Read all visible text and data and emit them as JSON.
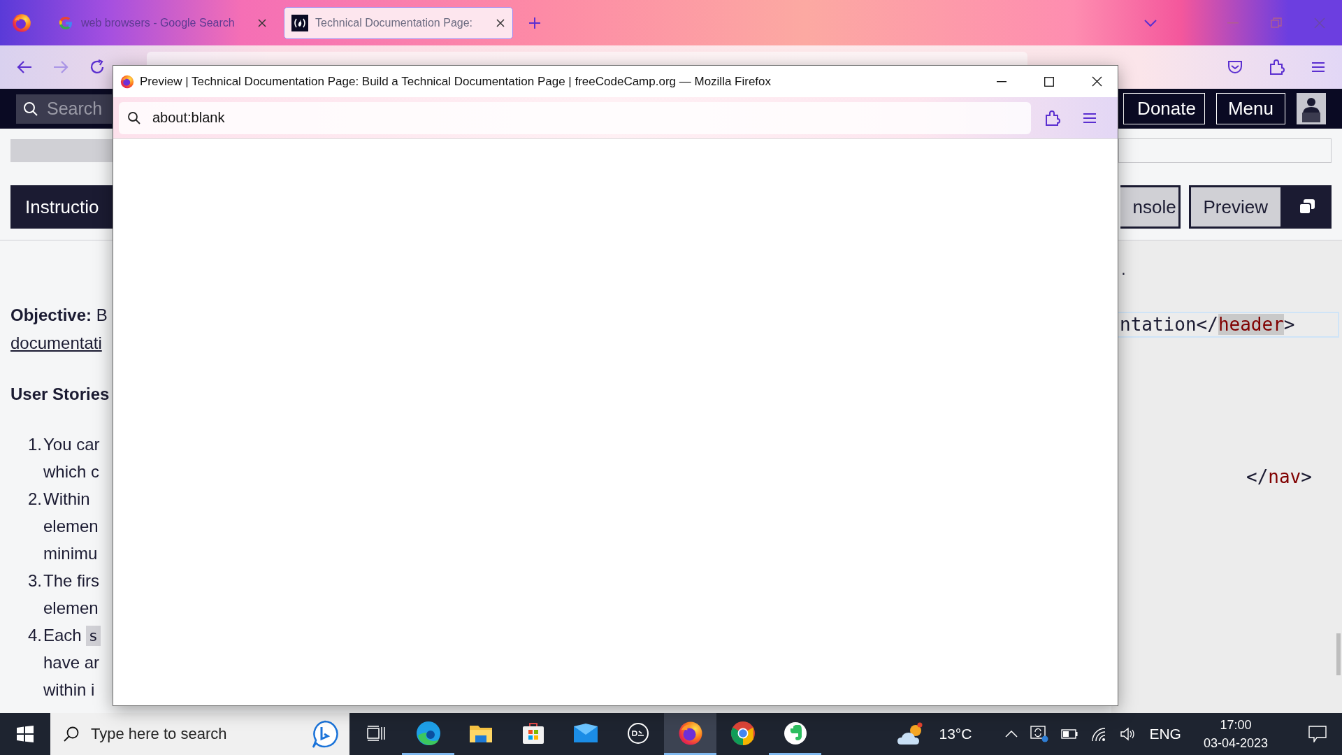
{
  "browser": {
    "tabs": [
      {
        "title": "web browsers - Google Search",
        "selected": false
      },
      {
        "title": "Technical Documentation Page:",
        "selected": true
      }
    ]
  },
  "site_nav": {
    "search_placeholder": "Search",
    "buttons": [
      "Donate",
      "Menu"
    ]
  },
  "left_tabs": [
    {
      "label": "Instructio",
      "selected": true
    }
  ],
  "right_tabs": [
    {
      "label": "nsole",
      "selected": false
    },
    {
      "label": "Preview",
      "selected": false
    }
  ],
  "instructions": {
    "objective_label": "Objective:",
    "objective_text": "B",
    "objective_link": "documentati",
    "heading": "User Stories",
    "items": [
      {
        "number": "1.",
        "lines": [
          "You car",
          "which c"
        ]
      },
      {
        "number": "2.",
        "lines": [
          "Within",
          "elemen",
          "minimu"
        ]
      },
      {
        "number": "3.",
        "lines": [
          "The firs",
          "elemen"
        ]
      },
      {
        "number": "4.",
        "lines": [
          "Each",
          "have ar",
          "within i"
        ],
        "code": "s"
      }
    ]
  },
  "editor": {
    "lines": [
      {
        "active": false,
        "parts": [
          {
            "kind": "text",
            "text": "."
          }
        ]
      },
      {
        "active": true,
        "parts": [
          {
            "kind": "text",
            "text": "ntation</"
          },
          {
            "kind": "tag",
            "text": "header",
            "matched": true
          },
          {
            "kind": "text",
            "text": ">"
          }
        ]
      },
      {
        "active": false,
        "parts": [
          {
            "kind": "text",
            "text": "</"
          },
          {
            "kind": "tag",
            "text": "nav",
            "matched": false
          },
          {
            "kind": "text",
            "text": ">"
          }
        ]
      }
    ]
  },
  "preview_window": {
    "title": "Preview | Technical Documentation Page: Build a Technical Documentation Page | freeCodeCamp.org — Mozilla Firefox",
    "url": "about:blank"
  },
  "taskbar": {
    "search_placeholder": "Type here to search",
    "apps": [
      {
        "kind": "task-view",
        "running": false,
        "selected": false
      },
      {
        "kind": "edge",
        "running": true,
        "selected": false
      },
      {
        "kind": "explorer",
        "running": false,
        "selected": false
      },
      {
        "kind": "store",
        "running": false,
        "selected": false
      },
      {
        "kind": "mail",
        "running": false,
        "selected": false
      },
      {
        "kind": "dell",
        "running": false,
        "selected": false
      },
      {
        "kind": "firefox",
        "running": true,
        "selected": true
      },
      {
        "kind": "chrome",
        "running": false,
        "selected": false
      },
      {
        "kind": "evernote",
        "running": true,
        "selected": false
      }
    ],
    "temperature": "13°C",
    "language": "ENG",
    "time": "17:00",
    "date": "03-04-2023"
  }
}
